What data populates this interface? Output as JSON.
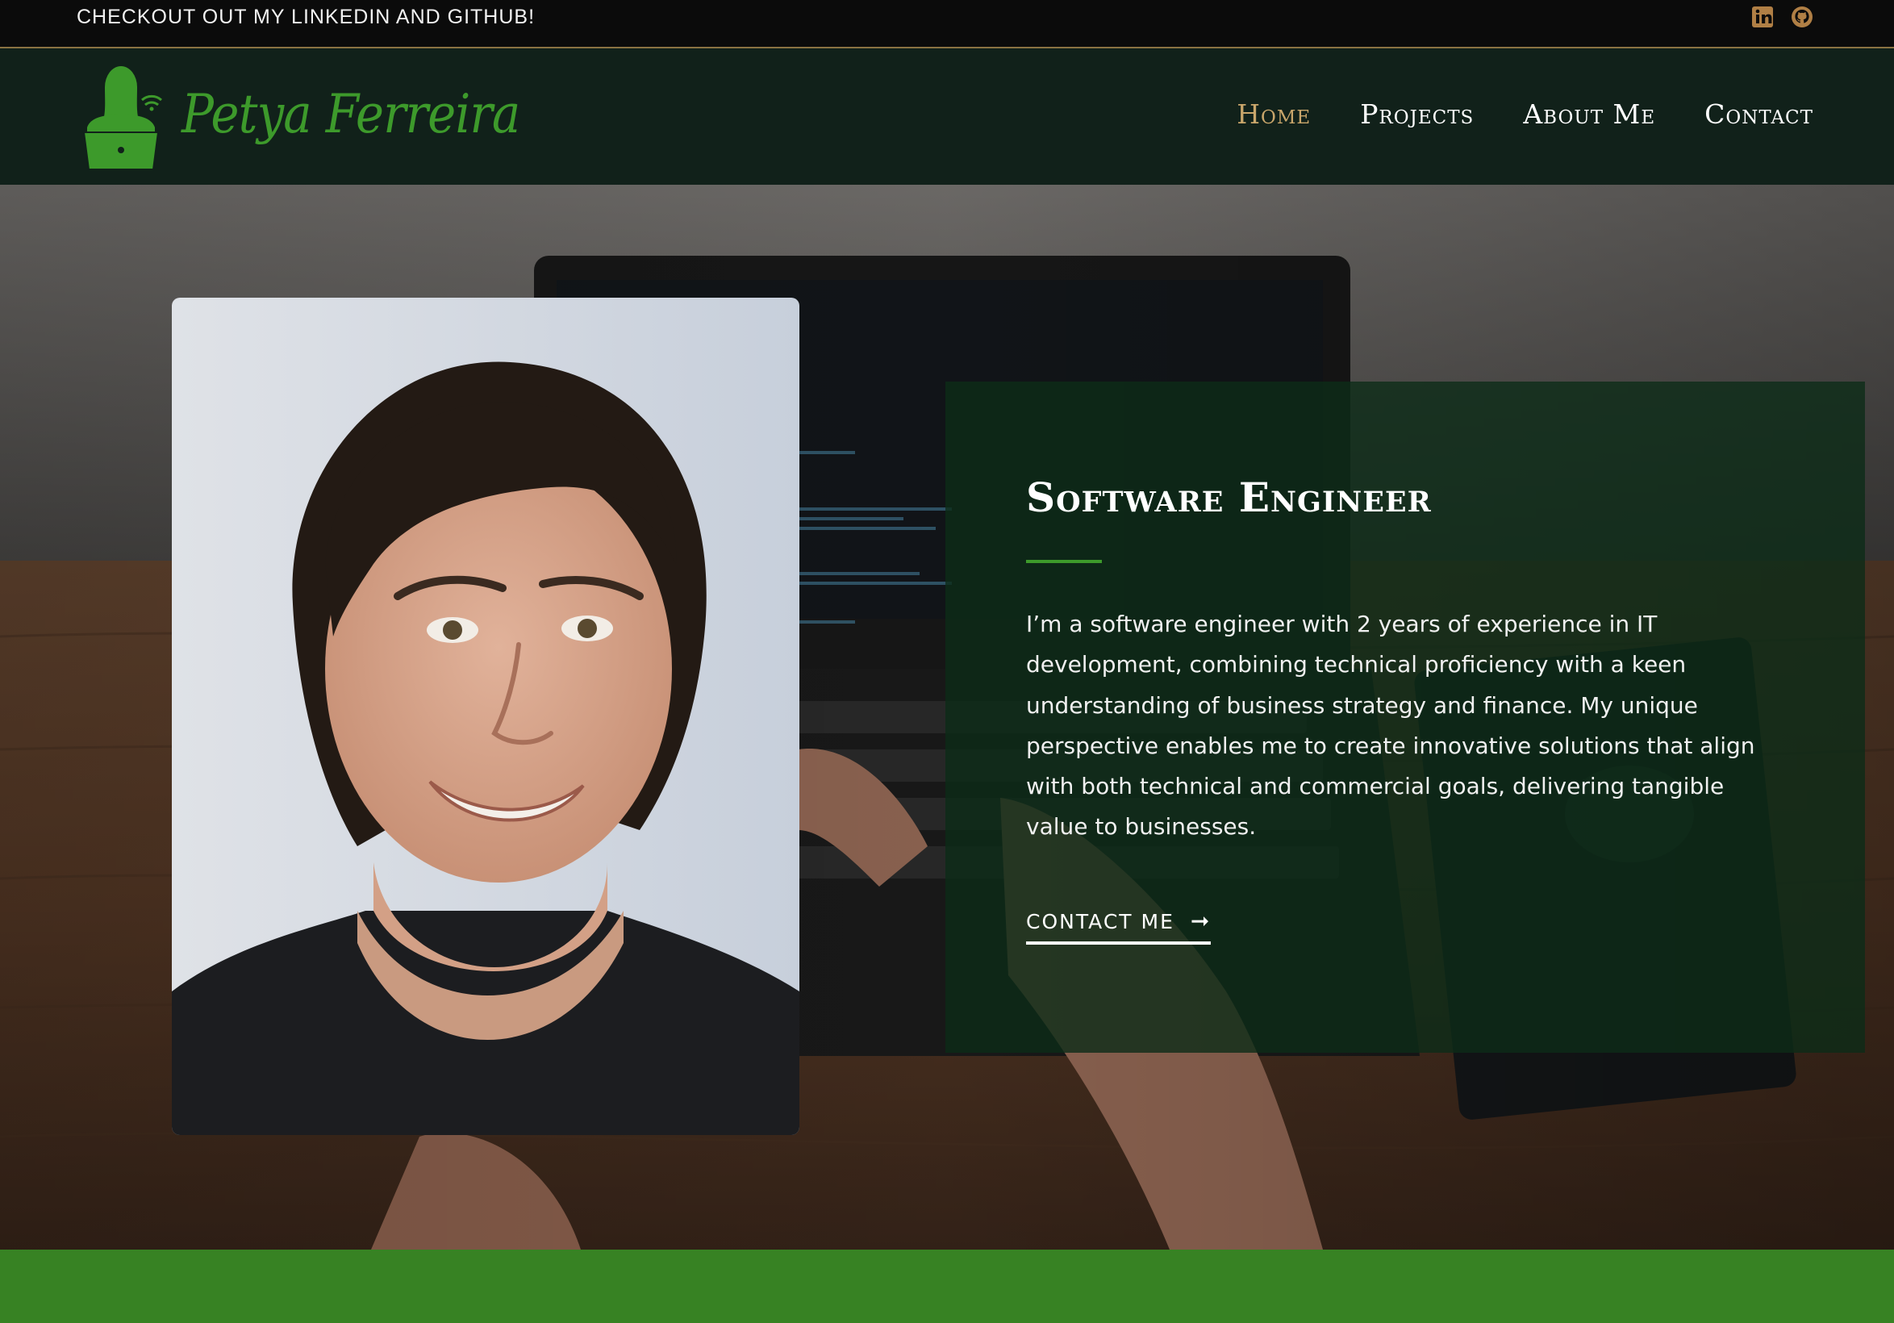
{
  "topbar": {
    "message": "CHECKOUT OUT MY LINKEDIN AND GITHUB!",
    "icons": [
      "linkedin-icon",
      "github-icon"
    ],
    "border_color": "#8a7242"
  },
  "header": {
    "logo_text": "Petya Ferreira",
    "nav": [
      {
        "label": "Home",
        "active": true
      },
      {
        "label": "Projects",
        "active": false
      },
      {
        "label": "About Me",
        "active": false
      },
      {
        "label": "Contact",
        "active": false
      }
    ]
  },
  "hero": {
    "title": "Software Engineer",
    "description": "I’m a software engineer with 2 years of experience in IT development, combining technical proficiency with a keen understanding of business strategy and finance. My unique perspective enables me to create innovative solutions that align with both technical and commercial goals, delivering tangible value to businesses.",
    "cta_label": "CONTACT ME",
    "cta_icon": "arrow-right-icon"
  },
  "colors": {
    "brand_green": "#3d9a2b",
    "accent_gold": "#c9a66b",
    "nav_bg": "#11211a",
    "band_green": "#378223"
  }
}
